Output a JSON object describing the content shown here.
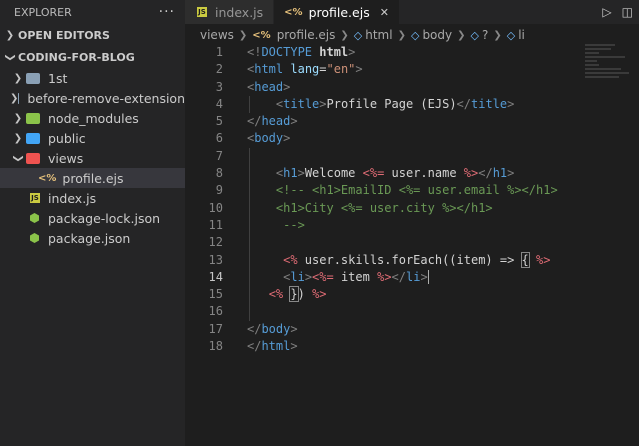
{
  "sidebar": {
    "title": "EXPLORER",
    "more_label": "···",
    "open_editors_label": "OPEN EDITORS",
    "project_label": "CODING-FOR-BLOG",
    "items": [
      {
        "label": "1st",
        "type": "folder",
        "color": "#8aa0b5"
      },
      {
        "label": "before-remove-extension",
        "type": "folder",
        "color": "#8aa0b5"
      },
      {
        "label": "node_modules",
        "type": "folder",
        "color": "#8bc34a"
      },
      {
        "label": "public",
        "type": "folder",
        "color": "#42a5f5"
      },
      {
        "label": "views",
        "type": "folder-open",
        "color": "#ef5350"
      },
      {
        "label": "profile.ejs",
        "type": "ejs"
      },
      {
        "label": "index.js",
        "type": "js"
      },
      {
        "label": "package-lock.json",
        "type": "json"
      },
      {
        "label": "package.json",
        "type": "json"
      }
    ]
  },
  "tabs": [
    {
      "label": "index.js",
      "icon": "JS",
      "active": false
    },
    {
      "label": "profile.ejs",
      "icon": "<%",
      "active": true
    }
  ],
  "breadcrumb": {
    "parts": [
      "views",
      "profile.ejs",
      "html",
      "body",
      "?",
      "li"
    ]
  },
  "editor": {
    "current_line": 14,
    "lines": [
      {
        "n": "1"
      },
      {
        "n": "2"
      },
      {
        "n": "3"
      },
      {
        "n": "4"
      },
      {
        "n": "5"
      },
      {
        "n": "6"
      },
      {
        "n": "7"
      },
      {
        "n": "8"
      },
      {
        "n": "9"
      },
      {
        "n": "10"
      },
      {
        "n": "11"
      },
      {
        "n": "12"
      },
      {
        "n": "13"
      },
      {
        "n": "14"
      },
      {
        "n": "15"
      },
      {
        "n": "16"
      },
      {
        "n": "17"
      },
      {
        "n": "18"
      }
    ],
    "code": {
      "l1": {
        "a": "<!",
        "b": "DOCTYPE",
        "c": " html",
        "d": ">"
      },
      "l2": {
        "a": "<",
        "b": "html",
        "c": " lang",
        "d": "=",
        "e": "\"en\"",
        "f": ">"
      },
      "l3": {
        "a": "<",
        "b": "head",
        "c": ">"
      },
      "l4": {
        "a": "<",
        "b": "title",
        "c": ">",
        "d": "Profile Page (EJS)",
        "e": "</",
        "f": "title",
        "g": ">"
      },
      "l5": {
        "a": "</",
        "b": "head",
        "c": ">"
      },
      "l6": {
        "a": "<",
        "b": "body",
        "c": ">"
      },
      "l8": {
        "a": "<",
        "b": "h1",
        "c": ">",
        "d": "Welcome ",
        "e": "<%=",
        "f": " user.name ",
        "g": "%>",
        "h": "</",
        "i": "h1",
        "j": ">"
      },
      "l9": {
        "a": "<!-- <h1>EmailID <%= user.email %></h1>"
      },
      "l10": {
        "a": "<h1>City <%= user.city %></h1>"
      },
      "l11": {
        "a": "-->"
      },
      "l13": {
        "a": "<%",
        "b": " user.skills.forEach((item) => ",
        "c": "{",
        "d": " %>"
      },
      "l14": {
        "a": "<",
        "b": "li",
        "c": ">",
        "d": "<%=",
        "e": " item ",
        "f": "%>",
        "g": "</",
        "h": "li",
        "i": ">"
      },
      "l15": {
        "a": "<%",
        "b": " ",
        "c": "}",
        "d": ") ",
        "e": "%>"
      },
      "l17": {
        "a": "</",
        "b": "body",
        "c": ">"
      },
      "l18": {
        "a": "</",
        "b": "html",
        "c": ">"
      }
    }
  },
  "colors": {
    "background": "#1e1e1e",
    "sidebar": "#252526",
    "tag": "#569cd6",
    "ejs_delimiter": "#e06c75",
    "comment": "#6a9955",
    "string": "#ce9178",
    "attribute": "#9cdcfe"
  }
}
